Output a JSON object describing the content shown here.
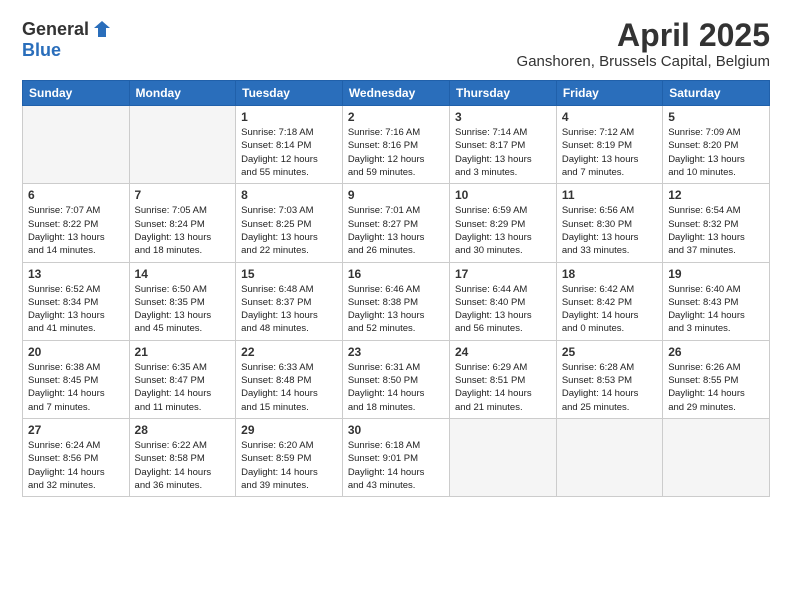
{
  "logo": {
    "general": "General",
    "blue": "Blue"
  },
  "header": {
    "month": "April 2025",
    "location": "Ganshoren, Brussels Capital, Belgium"
  },
  "weekdays": [
    "Sunday",
    "Monday",
    "Tuesday",
    "Wednesday",
    "Thursday",
    "Friday",
    "Saturday"
  ],
  "weeks": [
    [
      {
        "num": "",
        "info": ""
      },
      {
        "num": "",
        "info": ""
      },
      {
        "num": "1",
        "info": "Sunrise: 7:18 AM\nSunset: 8:14 PM\nDaylight: 12 hours\nand 55 minutes."
      },
      {
        "num": "2",
        "info": "Sunrise: 7:16 AM\nSunset: 8:16 PM\nDaylight: 12 hours\nand 59 minutes."
      },
      {
        "num": "3",
        "info": "Sunrise: 7:14 AM\nSunset: 8:17 PM\nDaylight: 13 hours\nand 3 minutes."
      },
      {
        "num": "4",
        "info": "Sunrise: 7:12 AM\nSunset: 8:19 PM\nDaylight: 13 hours\nand 7 minutes."
      },
      {
        "num": "5",
        "info": "Sunrise: 7:09 AM\nSunset: 8:20 PM\nDaylight: 13 hours\nand 10 minutes."
      }
    ],
    [
      {
        "num": "6",
        "info": "Sunrise: 7:07 AM\nSunset: 8:22 PM\nDaylight: 13 hours\nand 14 minutes."
      },
      {
        "num": "7",
        "info": "Sunrise: 7:05 AM\nSunset: 8:24 PM\nDaylight: 13 hours\nand 18 minutes."
      },
      {
        "num": "8",
        "info": "Sunrise: 7:03 AM\nSunset: 8:25 PM\nDaylight: 13 hours\nand 22 minutes."
      },
      {
        "num": "9",
        "info": "Sunrise: 7:01 AM\nSunset: 8:27 PM\nDaylight: 13 hours\nand 26 minutes."
      },
      {
        "num": "10",
        "info": "Sunrise: 6:59 AM\nSunset: 8:29 PM\nDaylight: 13 hours\nand 30 minutes."
      },
      {
        "num": "11",
        "info": "Sunrise: 6:56 AM\nSunset: 8:30 PM\nDaylight: 13 hours\nand 33 minutes."
      },
      {
        "num": "12",
        "info": "Sunrise: 6:54 AM\nSunset: 8:32 PM\nDaylight: 13 hours\nand 37 minutes."
      }
    ],
    [
      {
        "num": "13",
        "info": "Sunrise: 6:52 AM\nSunset: 8:34 PM\nDaylight: 13 hours\nand 41 minutes."
      },
      {
        "num": "14",
        "info": "Sunrise: 6:50 AM\nSunset: 8:35 PM\nDaylight: 13 hours\nand 45 minutes."
      },
      {
        "num": "15",
        "info": "Sunrise: 6:48 AM\nSunset: 8:37 PM\nDaylight: 13 hours\nand 48 minutes."
      },
      {
        "num": "16",
        "info": "Sunrise: 6:46 AM\nSunset: 8:38 PM\nDaylight: 13 hours\nand 52 minutes."
      },
      {
        "num": "17",
        "info": "Sunrise: 6:44 AM\nSunset: 8:40 PM\nDaylight: 13 hours\nand 56 minutes."
      },
      {
        "num": "18",
        "info": "Sunrise: 6:42 AM\nSunset: 8:42 PM\nDaylight: 14 hours\nand 0 minutes."
      },
      {
        "num": "19",
        "info": "Sunrise: 6:40 AM\nSunset: 8:43 PM\nDaylight: 14 hours\nand 3 minutes."
      }
    ],
    [
      {
        "num": "20",
        "info": "Sunrise: 6:38 AM\nSunset: 8:45 PM\nDaylight: 14 hours\nand 7 minutes."
      },
      {
        "num": "21",
        "info": "Sunrise: 6:35 AM\nSunset: 8:47 PM\nDaylight: 14 hours\nand 11 minutes."
      },
      {
        "num": "22",
        "info": "Sunrise: 6:33 AM\nSunset: 8:48 PM\nDaylight: 14 hours\nand 15 minutes."
      },
      {
        "num": "23",
        "info": "Sunrise: 6:31 AM\nSunset: 8:50 PM\nDaylight: 14 hours\nand 18 minutes."
      },
      {
        "num": "24",
        "info": "Sunrise: 6:29 AM\nSunset: 8:51 PM\nDaylight: 14 hours\nand 21 minutes."
      },
      {
        "num": "25",
        "info": "Sunrise: 6:28 AM\nSunset: 8:53 PM\nDaylight: 14 hours\nand 25 minutes."
      },
      {
        "num": "26",
        "info": "Sunrise: 6:26 AM\nSunset: 8:55 PM\nDaylight: 14 hours\nand 29 minutes."
      }
    ],
    [
      {
        "num": "27",
        "info": "Sunrise: 6:24 AM\nSunset: 8:56 PM\nDaylight: 14 hours\nand 32 minutes."
      },
      {
        "num": "28",
        "info": "Sunrise: 6:22 AM\nSunset: 8:58 PM\nDaylight: 14 hours\nand 36 minutes."
      },
      {
        "num": "29",
        "info": "Sunrise: 6:20 AM\nSunset: 8:59 PM\nDaylight: 14 hours\nand 39 minutes."
      },
      {
        "num": "30",
        "info": "Sunrise: 6:18 AM\nSunset: 9:01 PM\nDaylight: 14 hours\nand 43 minutes."
      },
      {
        "num": "",
        "info": ""
      },
      {
        "num": "",
        "info": ""
      },
      {
        "num": "",
        "info": ""
      }
    ]
  ]
}
